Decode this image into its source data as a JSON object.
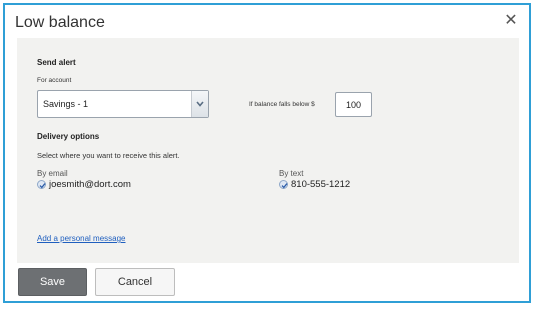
{
  "dialog": {
    "title": "Low balance",
    "close_icon": "close-icon",
    "send_alert": {
      "heading": "Send alert",
      "account_label": "For account",
      "account_selected": "Savings - 1",
      "threshold_label": "If balance falls below $",
      "threshold_value": "100"
    },
    "delivery": {
      "heading": "Delivery options",
      "description": "Select where you want to receive this alert.",
      "email_label": "By email",
      "email_value": "joesmith@dort.com",
      "email_checked": true,
      "text_label": "By text",
      "text_value": "810-555-1212",
      "text_checked": true
    },
    "personal_message_link": "Add a personal message",
    "buttons": {
      "save": "Save",
      "cancel": "Cancel"
    },
    "colors": {
      "border_accent": "#2f9fd6",
      "save_bg": "#6d7073",
      "link": "#1f5fbf"
    }
  }
}
